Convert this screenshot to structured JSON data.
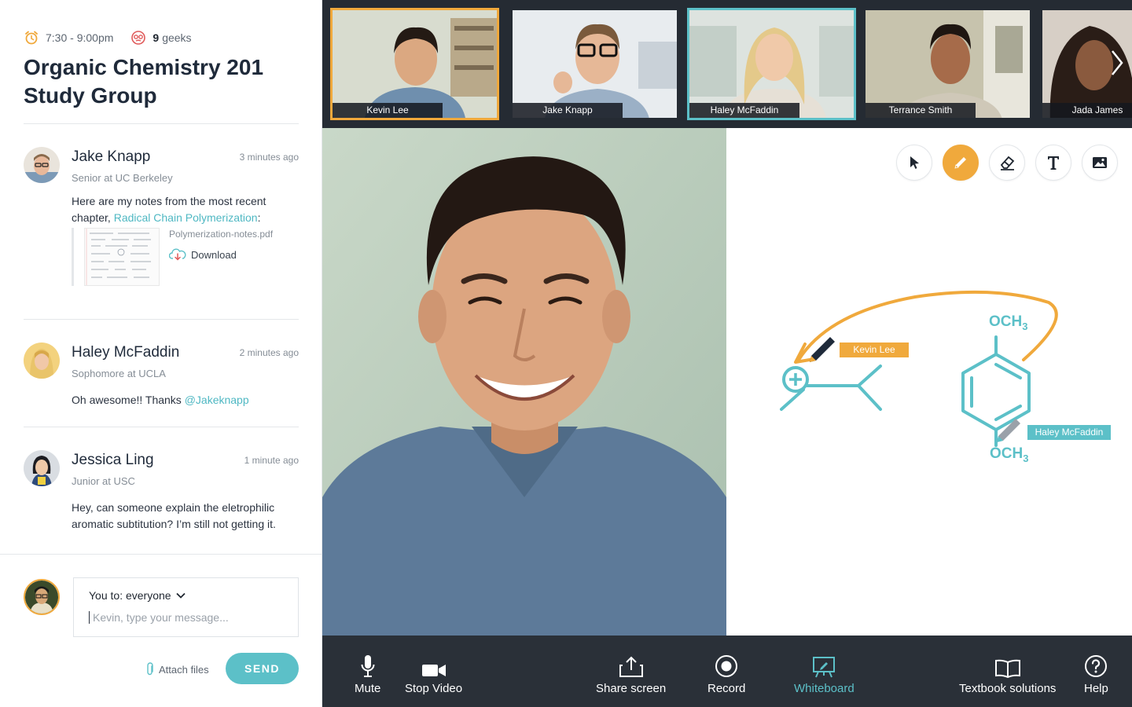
{
  "session": {
    "time": "7:30 - 9:00pm",
    "geek_count": "9",
    "geek_label": "geeks",
    "title": "Organic Chemistry 201 Study Group"
  },
  "messages": [
    {
      "name": "Jake Knapp",
      "time": "3 minutes ago",
      "role": "Senior at UC Berkeley",
      "text": "Here are my notes from the most recent chapter, ",
      "link": "Radical Chain Polymerization",
      "text_after": ":",
      "attachment": {
        "filename": "Polymerization-notes.pdf",
        "action": "Download"
      }
    },
    {
      "name": "Haley McFaddin",
      "time": "2 minutes ago",
      "role": "Sophomore at UCLA",
      "text": "Oh awesome!! Thanks ",
      "mention": "@Jakeknapp"
    },
    {
      "name": "Jessica Ling",
      "time": "1 minute ago",
      "role": "Junior at USC",
      "text": "Hey, can someone explain the eletrophilic aromatic subtitution? I’m still not getting it."
    }
  ],
  "compose": {
    "recipient": "You to: everyone",
    "placeholder": "Kevin, type your message...",
    "attach_label": "Attach files",
    "send_label": "SEND"
  },
  "participants": [
    {
      "name": "Kevin Lee"
    },
    {
      "name": "Jake Knapp"
    },
    {
      "name": "Haley McFaddin"
    },
    {
      "name": "Terrance Smith"
    },
    {
      "name": "Jada James"
    }
  ],
  "whiteboard": {
    "labels": {
      "top": "OCH",
      "top_sub": "3",
      "bottom": "OCH",
      "bottom_sub": "3"
    },
    "cursors": [
      {
        "name": "Kevin Lee",
        "color": "#f0a93c"
      },
      {
        "name": "Haley McFaddin",
        "color": "#5cc0c8"
      }
    ]
  },
  "toolbar": {
    "mute": "Mute",
    "stop_video": "Stop Video",
    "share_screen": "Share screen",
    "record": "Record",
    "whiteboard": "Whiteboard",
    "textbook": "Textbook solutions",
    "help": "Help"
  },
  "colors": {
    "accent_orange": "#f0a93c",
    "accent_teal": "#5cc0c8",
    "toolbar_bg": "#2a3038"
  }
}
